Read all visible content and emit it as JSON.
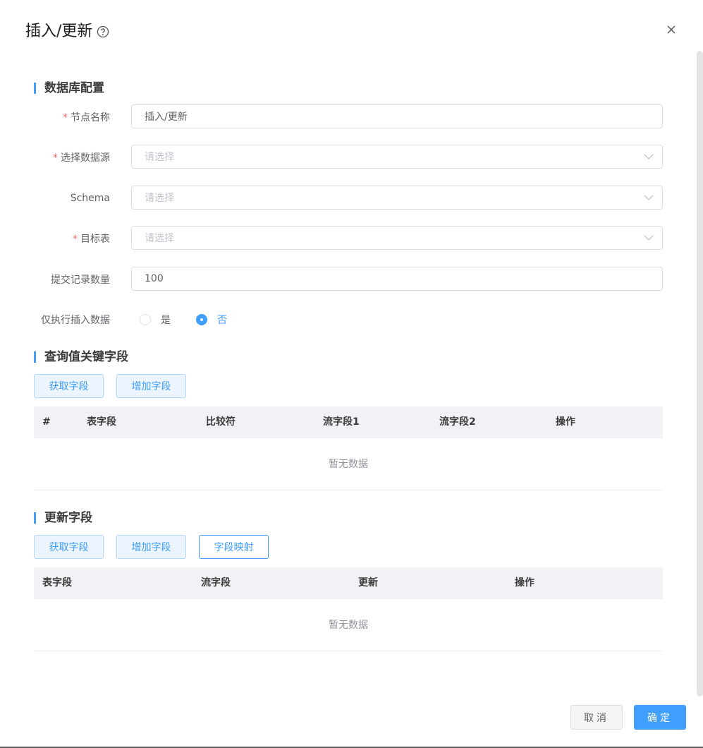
{
  "dialog": {
    "title": "插入/更新",
    "help_icon": "question-circle-icon",
    "close_icon": "close-icon"
  },
  "db_section": {
    "title": "数据库配置",
    "node_name": {
      "label": "节点名称",
      "required": true,
      "value": "插入/更新"
    },
    "datasource": {
      "label": "选择数据源",
      "required": true,
      "placeholder": "请选择"
    },
    "schema": {
      "label": "Schema",
      "required": false,
      "placeholder": "请选择"
    },
    "target_table": {
      "label": "目标表",
      "required": true,
      "placeholder": "请选择"
    },
    "commit_count": {
      "label": "提交记录数量",
      "value": "100"
    },
    "insert_only": {
      "label": "仅执行插入数据",
      "options": [
        "是",
        "否"
      ],
      "selected": "否"
    }
  },
  "query_section": {
    "title": "查询值关键字段",
    "get_fields_btn": "获取字段",
    "add_field_btn": "增加字段",
    "columns": [
      "#",
      "表字段",
      "比较符",
      "流字段1",
      "流字段2",
      "操作"
    ],
    "empty_text": "暂无数据"
  },
  "update_section": {
    "title": "更新字段",
    "get_fields_btn": "获取字段",
    "add_field_btn": "增加字段",
    "map_fields_btn": "字段映射",
    "columns": [
      "表字段",
      "流字段",
      "更新",
      "操作"
    ],
    "empty_text": "暂无数据"
  },
  "footer": {
    "cancel": "取消",
    "confirm": "确定"
  },
  "colors": {
    "accent": "#409eff",
    "required": "#f56c6c",
    "table_header_bg": "#f0f2f5"
  }
}
